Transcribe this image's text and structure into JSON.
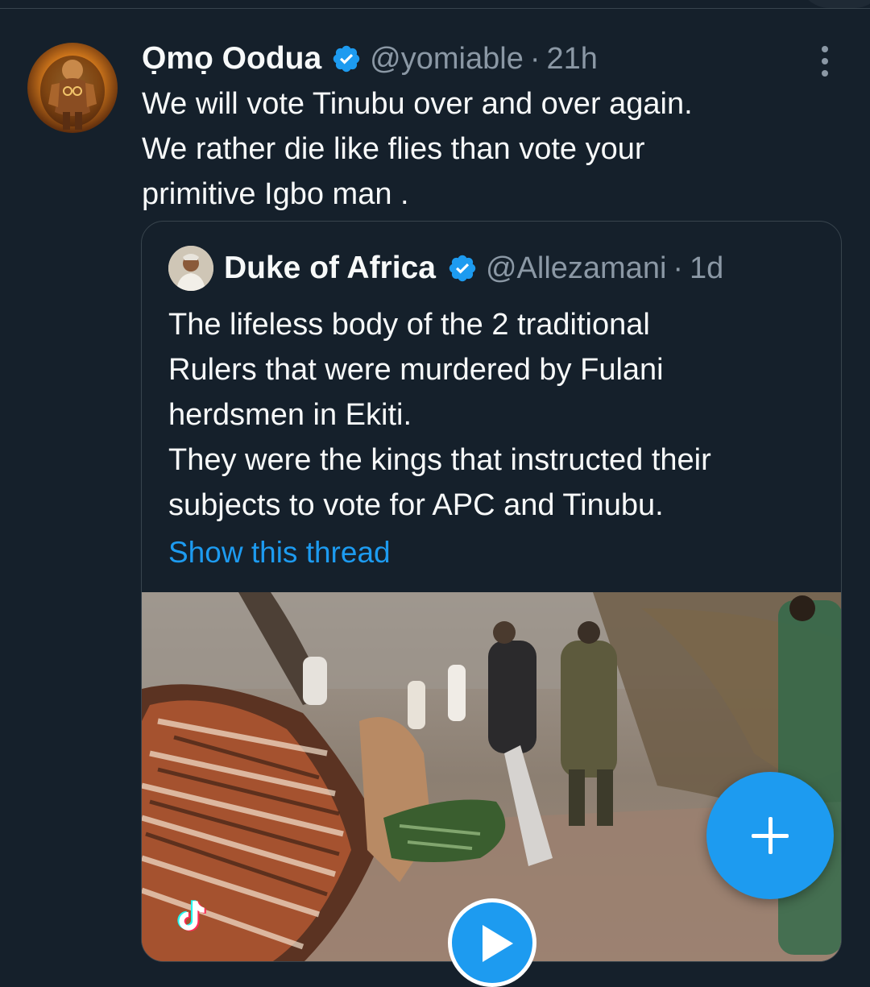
{
  "tweet": {
    "author": {
      "name": "Ọmọ Oodua",
      "handle": "@yomiable",
      "separator": "·",
      "time": "21h",
      "verified": true
    },
    "text_lines": [
      "We will vote Tinubu over and over again.",
      "We rather die like flies than vote your",
      "primitive Igbo man ."
    ],
    "menu_icon": "more-vertical-icon"
  },
  "quoted_tweet": {
    "author": {
      "name": "Duke of Africa",
      "handle": "@Allezamani",
      "separator": "·",
      "time": "1d",
      "verified": true
    },
    "text_lines": [
      "The lifeless body of the 2 traditional",
      "Rulers  that were murdered by Fulani",
      "herdsmen in Ekiti.",
      "They were the kings that instructed their",
      "subjects to vote for APC and Tinubu."
    ],
    "show_thread_label": "Show this thread",
    "media": {
      "type": "video",
      "watermark_icon": "tiktok-icon",
      "play_icon": "play-icon"
    }
  },
  "compose_button": {
    "icon": "plus-icon"
  },
  "colors": {
    "background": "#15202b",
    "text_primary": "#f7f9f9",
    "text_secondary": "#8b98a5",
    "accent": "#1d9bf0",
    "border": "#38444d"
  }
}
